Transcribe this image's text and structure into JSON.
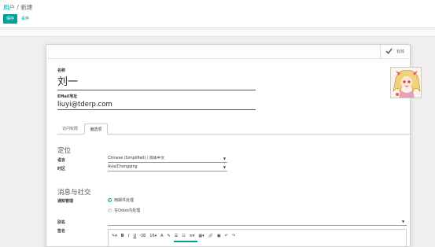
{
  "breadcrumb": {
    "parent": "用户",
    "separator": "/",
    "current": "新建"
  },
  "actions": {
    "save": "保存",
    "discard": "丢弃"
  },
  "statusbar": {
    "active": "有效"
  },
  "form": {
    "name_label": "名称",
    "name_value": "刘一",
    "email_label": "EMail地址",
    "email_value": "liuyi@tderp.com"
  },
  "tabs": [
    {
      "label": "访问权限"
    },
    {
      "label": "偏选项"
    }
  ],
  "locale": {
    "title": "定位",
    "language_label": "语言",
    "language_value": "Chinese (Simplified) / 简体中文",
    "timezone_label": "时区",
    "timezone_value": "Asia/Chongqing"
  },
  "messaging": {
    "title": "消息与社交",
    "notify_label": "通知管理",
    "options": [
      {
        "label": "用邮件处理",
        "selected": true
      },
      {
        "label": "在Odoo内处理",
        "selected": false
      }
    ],
    "alias_label": "别名",
    "signature_label": "签名"
  },
  "editor_toolbar": {
    "style": "✎▾",
    "bold": "B",
    "italic": "I",
    "underline": "U",
    "eraser": "⌫",
    "font_size": "16▾",
    "font_color": "A",
    "highlight": "✎",
    "ul": "☰",
    "ol": "☷",
    "align": "≡▾",
    "table": "▦▾",
    "link": "🔗",
    "image": "▣",
    "undo": "↶",
    "redo": "↷"
  },
  "colors": {
    "accent": "#00a09d"
  }
}
